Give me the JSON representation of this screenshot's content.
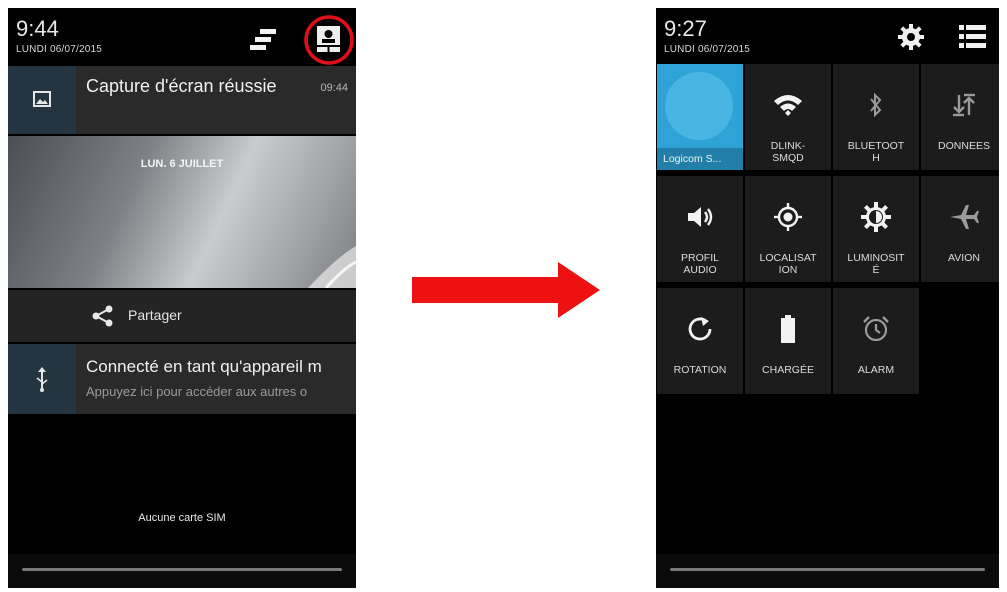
{
  "left": {
    "status": {
      "time": "9:44",
      "date": "LUNDI 06/07/2015"
    },
    "icons": {
      "clear": "clear-all-icon",
      "quick_settings": "quick-settings-icon"
    },
    "screenshot_notification": {
      "title": "Capture d'écran réussie",
      "time": "09:44",
      "preview_date": "LUN. 6 JUILLET",
      "share_label": "Partager"
    },
    "usb_notification": {
      "title": "Connecté en tant qu'appareil m",
      "subtitle": "Appuyez ici pour accéder aux autres o"
    },
    "no_sim": "Aucune carte SIM"
  },
  "arrow_color": "#ee1111",
  "highlight_color": "#e0101a",
  "right": {
    "status": {
      "time": "9:27",
      "date": "LUNDI 06/07/2015"
    },
    "icons": {
      "settings": "gear-icon",
      "notifications_list": "list-icon"
    },
    "tiles": [
      {
        "label": "Logicom S...",
        "icon": "user-avatar-icon"
      },
      {
        "label": "DLINK-\nSMQD",
        "icon": "wifi-icon"
      },
      {
        "label": "BLUETOOT\nH",
        "icon": "bluetooth-icon"
      },
      {
        "label": "DONNEES",
        "icon": "data-icon"
      },
      {
        "label": "PROFIL\nAUDIO",
        "icon": "volume-icon"
      },
      {
        "label": "LOCALISAT\nION",
        "icon": "location-icon"
      },
      {
        "label": "LUMINOSIT\nÉ",
        "icon": "brightness-icon"
      },
      {
        "label": "AVION",
        "icon": "airplane-icon"
      },
      {
        "label": "ROTATION",
        "icon": "rotation-icon"
      },
      {
        "label": "CHARGÉE",
        "icon": "battery-icon"
      },
      {
        "label": "ALARM",
        "icon": "alarm-icon"
      }
    ]
  }
}
